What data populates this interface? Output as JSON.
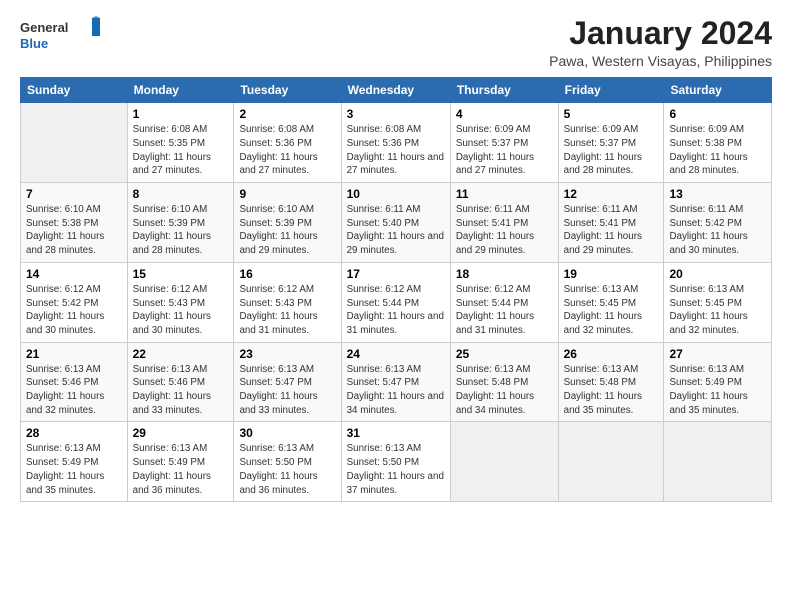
{
  "logo": {
    "text_general": "General",
    "text_blue": "Blue"
  },
  "header": {
    "title": "January 2024",
    "subtitle": "Pawa, Western Visayas, Philippines"
  },
  "days_of_week": [
    "Sunday",
    "Monday",
    "Tuesday",
    "Wednesday",
    "Thursday",
    "Friday",
    "Saturday"
  ],
  "weeks": [
    {
      "days": [
        {
          "num": "",
          "sunrise": "",
          "sunset": "",
          "daylight": "",
          "empty": true
        },
        {
          "num": "1",
          "sunrise": "Sunrise: 6:08 AM",
          "sunset": "Sunset: 5:35 PM",
          "daylight": "Daylight: 11 hours and 27 minutes."
        },
        {
          "num": "2",
          "sunrise": "Sunrise: 6:08 AM",
          "sunset": "Sunset: 5:36 PM",
          "daylight": "Daylight: 11 hours and 27 minutes."
        },
        {
          "num": "3",
          "sunrise": "Sunrise: 6:08 AM",
          "sunset": "Sunset: 5:36 PM",
          "daylight": "Daylight: 11 hours and 27 minutes."
        },
        {
          "num": "4",
          "sunrise": "Sunrise: 6:09 AM",
          "sunset": "Sunset: 5:37 PM",
          "daylight": "Daylight: 11 hours and 27 minutes."
        },
        {
          "num": "5",
          "sunrise": "Sunrise: 6:09 AM",
          "sunset": "Sunset: 5:37 PM",
          "daylight": "Daylight: 11 hours and 28 minutes."
        },
        {
          "num": "6",
          "sunrise": "Sunrise: 6:09 AM",
          "sunset": "Sunset: 5:38 PM",
          "daylight": "Daylight: 11 hours and 28 minutes."
        }
      ]
    },
    {
      "days": [
        {
          "num": "7",
          "sunrise": "Sunrise: 6:10 AM",
          "sunset": "Sunset: 5:38 PM",
          "daylight": "Daylight: 11 hours and 28 minutes."
        },
        {
          "num": "8",
          "sunrise": "Sunrise: 6:10 AM",
          "sunset": "Sunset: 5:39 PM",
          "daylight": "Daylight: 11 hours and 28 minutes."
        },
        {
          "num": "9",
          "sunrise": "Sunrise: 6:10 AM",
          "sunset": "Sunset: 5:39 PM",
          "daylight": "Daylight: 11 hours and 29 minutes."
        },
        {
          "num": "10",
          "sunrise": "Sunrise: 6:11 AM",
          "sunset": "Sunset: 5:40 PM",
          "daylight": "Daylight: 11 hours and 29 minutes."
        },
        {
          "num": "11",
          "sunrise": "Sunrise: 6:11 AM",
          "sunset": "Sunset: 5:41 PM",
          "daylight": "Daylight: 11 hours and 29 minutes."
        },
        {
          "num": "12",
          "sunrise": "Sunrise: 6:11 AM",
          "sunset": "Sunset: 5:41 PM",
          "daylight": "Daylight: 11 hours and 29 minutes."
        },
        {
          "num": "13",
          "sunrise": "Sunrise: 6:11 AM",
          "sunset": "Sunset: 5:42 PM",
          "daylight": "Daylight: 11 hours and 30 minutes."
        }
      ]
    },
    {
      "days": [
        {
          "num": "14",
          "sunrise": "Sunrise: 6:12 AM",
          "sunset": "Sunset: 5:42 PM",
          "daylight": "Daylight: 11 hours and 30 minutes."
        },
        {
          "num": "15",
          "sunrise": "Sunrise: 6:12 AM",
          "sunset": "Sunset: 5:43 PM",
          "daylight": "Daylight: 11 hours and 30 minutes."
        },
        {
          "num": "16",
          "sunrise": "Sunrise: 6:12 AM",
          "sunset": "Sunset: 5:43 PM",
          "daylight": "Daylight: 11 hours and 31 minutes."
        },
        {
          "num": "17",
          "sunrise": "Sunrise: 6:12 AM",
          "sunset": "Sunset: 5:44 PM",
          "daylight": "Daylight: 11 hours and 31 minutes."
        },
        {
          "num": "18",
          "sunrise": "Sunrise: 6:12 AM",
          "sunset": "Sunset: 5:44 PM",
          "daylight": "Daylight: 11 hours and 31 minutes."
        },
        {
          "num": "19",
          "sunrise": "Sunrise: 6:13 AM",
          "sunset": "Sunset: 5:45 PM",
          "daylight": "Daylight: 11 hours and 32 minutes."
        },
        {
          "num": "20",
          "sunrise": "Sunrise: 6:13 AM",
          "sunset": "Sunset: 5:45 PM",
          "daylight": "Daylight: 11 hours and 32 minutes."
        }
      ]
    },
    {
      "days": [
        {
          "num": "21",
          "sunrise": "Sunrise: 6:13 AM",
          "sunset": "Sunset: 5:46 PM",
          "daylight": "Daylight: 11 hours and 32 minutes."
        },
        {
          "num": "22",
          "sunrise": "Sunrise: 6:13 AM",
          "sunset": "Sunset: 5:46 PM",
          "daylight": "Daylight: 11 hours and 33 minutes."
        },
        {
          "num": "23",
          "sunrise": "Sunrise: 6:13 AM",
          "sunset": "Sunset: 5:47 PM",
          "daylight": "Daylight: 11 hours and 33 minutes."
        },
        {
          "num": "24",
          "sunrise": "Sunrise: 6:13 AM",
          "sunset": "Sunset: 5:47 PM",
          "daylight": "Daylight: 11 hours and 34 minutes."
        },
        {
          "num": "25",
          "sunrise": "Sunrise: 6:13 AM",
          "sunset": "Sunset: 5:48 PM",
          "daylight": "Daylight: 11 hours and 34 minutes."
        },
        {
          "num": "26",
          "sunrise": "Sunrise: 6:13 AM",
          "sunset": "Sunset: 5:48 PM",
          "daylight": "Daylight: 11 hours and 35 minutes."
        },
        {
          "num": "27",
          "sunrise": "Sunrise: 6:13 AM",
          "sunset": "Sunset: 5:49 PM",
          "daylight": "Daylight: 11 hours and 35 minutes."
        }
      ]
    },
    {
      "days": [
        {
          "num": "28",
          "sunrise": "Sunrise: 6:13 AM",
          "sunset": "Sunset: 5:49 PM",
          "daylight": "Daylight: 11 hours and 35 minutes."
        },
        {
          "num": "29",
          "sunrise": "Sunrise: 6:13 AM",
          "sunset": "Sunset: 5:49 PM",
          "daylight": "Daylight: 11 hours and 36 minutes."
        },
        {
          "num": "30",
          "sunrise": "Sunrise: 6:13 AM",
          "sunset": "Sunset: 5:50 PM",
          "daylight": "Daylight: 11 hours and 36 minutes."
        },
        {
          "num": "31",
          "sunrise": "Sunrise: 6:13 AM",
          "sunset": "Sunset: 5:50 PM",
          "daylight": "Daylight: 11 hours and 37 minutes."
        },
        {
          "num": "",
          "sunrise": "",
          "sunset": "",
          "daylight": "",
          "empty": true
        },
        {
          "num": "",
          "sunrise": "",
          "sunset": "",
          "daylight": "",
          "empty": true
        },
        {
          "num": "",
          "sunrise": "",
          "sunset": "",
          "daylight": "",
          "empty": true
        }
      ]
    }
  ]
}
